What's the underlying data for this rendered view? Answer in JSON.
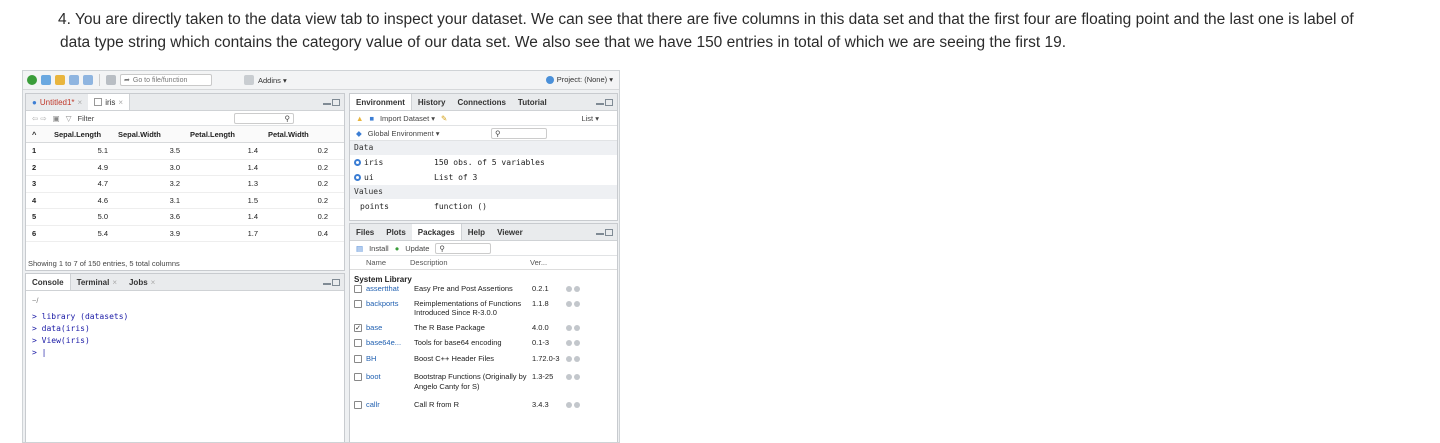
{
  "instruction": {
    "number": "4.",
    "line1": "You are directly taken to the data view tab to inspect your dataset. We can see that there are five columns in this data set and that the first four are floating point and the last one is label of",
    "line2": "data type string which contains the category value of our data set. We also see that we have 150 entries in total of which we are seeing the first 19."
  },
  "toolbar": {
    "goto_placeholder": "Go to file/function",
    "addins": "Addins ▾",
    "project": "Project: (None) ▾"
  },
  "source_pane": {
    "tabs": [
      {
        "label": "Untitled1*",
        "close": "×"
      },
      {
        "label": "iris",
        "close": "×"
      }
    ],
    "filter": "Filter",
    "columns": [
      "Sepal.Length",
      "Sepal.Width",
      "Petal.Length",
      "Petal.Width"
    ],
    "rows": [
      [
        "1",
        "5.1",
        "3.5",
        "1.4",
        "0.2"
      ],
      [
        "2",
        "4.9",
        "3.0",
        "1.4",
        "0.2"
      ],
      [
        "3",
        "4.7",
        "3.2",
        "1.3",
        "0.2"
      ],
      [
        "4",
        "4.6",
        "3.1",
        "1.5",
        "0.2"
      ],
      [
        "5",
        "5.0",
        "3.6",
        "1.4",
        "0.2"
      ],
      [
        "6",
        "5.4",
        "3.9",
        "1.7",
        "0.4"
      ]
    ],
    "footer": "Showing 1 to 7 of 150 entries, 5 total columns"
  },
  "console_pane": {
    "tabs": [
      "Console",
      "Terminal",
      "Jobs"
    ],
    "close": "×",
    "path": "~/",
    "lines": [
      "> library (datasets)",
      "> data(iris)",
      "> View(iris)",
      "> |"
    ]
  },
  "env_pane": {
    "tabs": [
      "Environment",
      "History",
      "Connections",
      "Tutorial"
    ],
    "import": "Import Dataset ▾",
    "list": "List ▾",
    "scope": "Global Environment ▾",
    "data_label": "Data",
    "data": [
      {
        "name": "iris",
        "value": "150 obs. of 5 variables"
      },
      {
        "name": "ui",
        "value": "List of 3"
      }
    ],
    "values_label": "Values",
    "values": [
      {
        "name": "points",
        "value": "function ()"
      }
    ]
  },
  "files_pane": {
    "tabs": [
      "Files",
      "Plots",
      "Packages",
      "Help",
      "Viewer"
    ],
    "install": "Install",
    "update": "Update",
    "headers": [
      "Name",
      "Description",
      "Ver..."
    ],
    "section": "System Library",
    "packages": [
      {
        "check": "",
        "name": "assertthat",
        "desc": "Easy Pre and Post Assertions",
        "ver": "0.2.1"
      },
      {
        "check": "",
        "name": "backports",
        "desc": "Reimplementations of Functions Introduced Since R-3.0.0",
        "ver": "1.1.8"
      },
      {
        "check": "✓",
        "name": "base",
        "desc": "The R Base Package",
        "ver": "4.0.0"
      },
      {
        "check": "",
        "name": "base64e...",
        "desc": "Tools for base64 encoding",
        "ver": "0.1-3"
      },
      {
        "check": "",
        "name": "BH",
        "desc": "Boost C++ Header Files",
        "ver": "1.72.0-3"
      },
      {
        "check": "",
        "name": "boot",
        "desc": "Bootstrap Functions (Originally by Angelo Canty for S)",
        "ver": "1.3-25"
      },
      {
        "check": "",
        "name": "callr",
        "desc": "Call R from R",
        "ver": "3.4.3"
      }
    ]
  },
  "colors": {
    "accent_blue": "#3c7ed4",
    "console_text": "#1a1aa6",
    "link_blue": "#1f5fb0"
  }
}
